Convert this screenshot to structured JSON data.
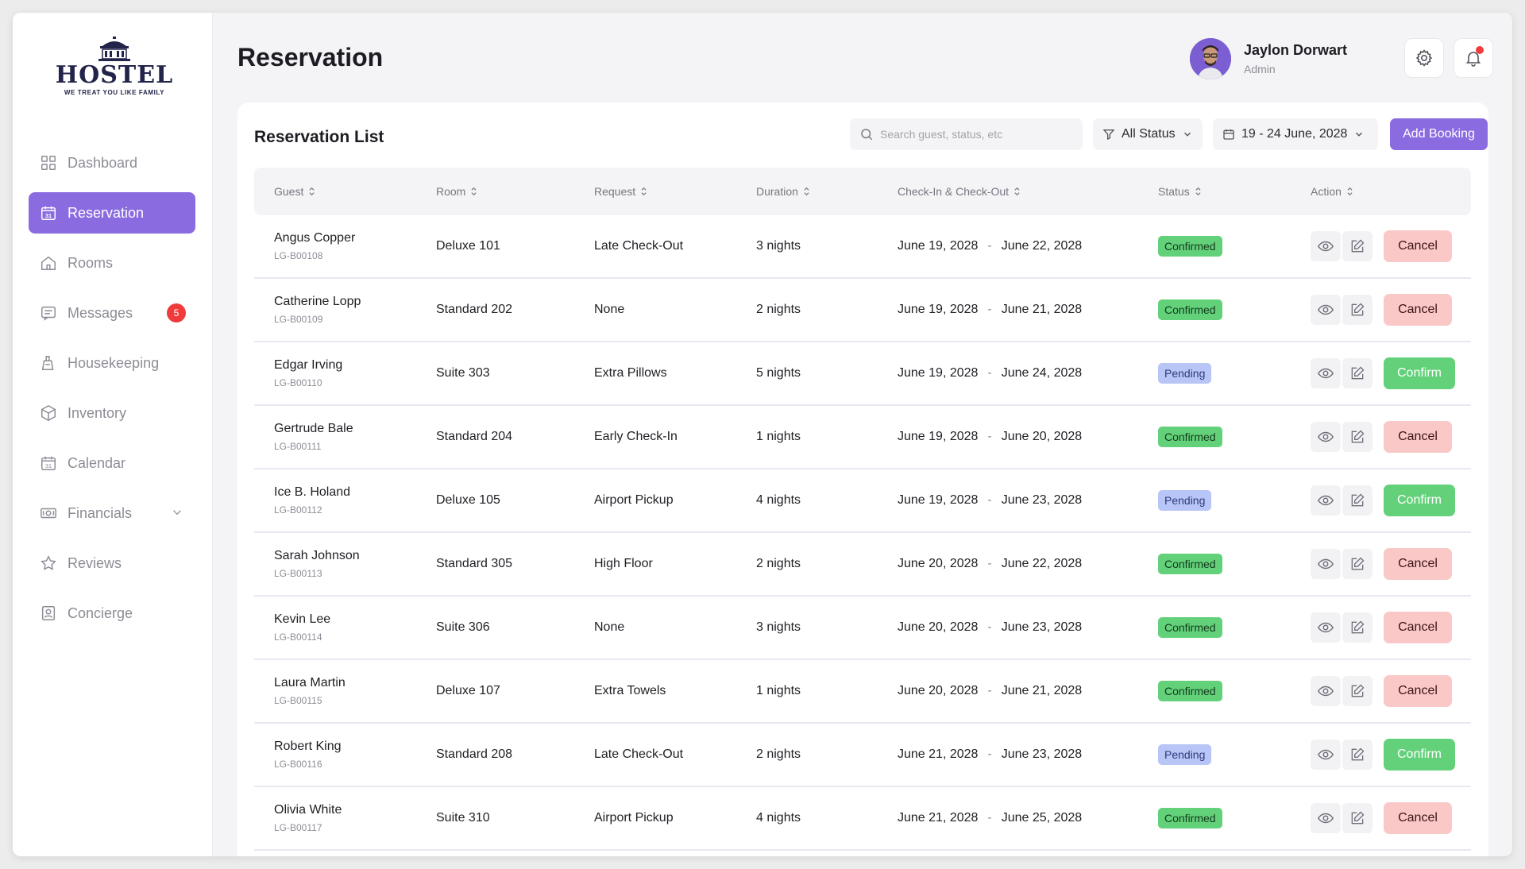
{
  "brand": {
    "name": "HOSTEL",
    "tagline": "WE TREAT YOU LIKE FAMILY"
  },
  "sidebar": {
    "items": [
      {
        "label": "Dashboard",
        "icon": "grid-icon",
        "active": false
      },
      {
        "label": "Reservation",
        "icon": "calendar-31-icon",
        "active": true
      },
      {
        "label": "Rooms",
        "icon": "home-icon",
        "active": false
      },
      {
        "label": "Messages",
        "icon": "message-icon",
        "active": false,
        "badge": "5"
      },
      {
        "label": "Housekeeping",
        "icon": "housekeeping-icon",
        "active": false
      },
      {
        "label": "Inventory",
        "icon": "box-icon",
        "active": false
      },
      {
        "label": "Calendar",
        "icon": "calendar-icon",
        "active": false
      },
      {
        "label": "Financials",
        "icon": "money-icon",
        "active": false,
        "expandable": true
      },
      {
        "label": "Reviews",
        "icon": "star-icon",
        "active": false
      },
      {
        "label": "Concierge",
        "icon": "concierge-icon",
        "active": false
      }
    ]
  },
  "header": {
    "title": "Reservation",
    "user": {
      "name": "Jaylon Dorwart",
      "role": "Admin"
    }
  },
  "panel": {
    "title": "Reservation List",
    "search_placeholder": "Search guest, status, etc",
    "status_filter": "All Status",
    "date_range": "19 - 24 June, 2028",
    "add_label": "Add Booking"
  },
  "table": {
    "columns": [
      "Guest",
      "Room",
      "Request",
      "Duration",
      "Check-In & Check-Out",
      "Status",
      "Action"
    ],
    "rows": [
      {
        "guest": "Angus Copper",
        "id": "LG-B00108",
        "room": "Deluxe 101",
        "request": "Late Check-Out",
        "duration": "3 nights",
        "checkin": "June 19, 2028",
        "checkout": "June 22, 2028",
        "status": "Confirmed",
        "action": "Cancel"
      },
      {
        "guest": "Catherine Lopp",
        "id": "LG-B00109",
        "room": "Standard 202",
        "request": "None",
        "duration": "2 nights",
        "checkin": "June 19, 2028",
        "checkout": "June 21, 2028",
        "status": "Confirmed",
        "action": "Cancel"
      },
      {
        "guest": "Edgar Irving",
        "id": "LG-B00110",
        "room": "Suite 303",
        "request": "Extra Pillows",
        "duration": "5 nights",
        "checkin": "June 19, 2028",
        "checkout": "June 24, 2028",
        "status": "Pending",
        "action": "Confirm"
      },
      {
        "guest": "Gertrude Bale",
        "id": "LG-B00111",
        "room": "Standard 204",
        "request": "Early Check-In",
        "duration": "1 nights",
        "checkin": "June 19, 2028",
        "checkout": "June 20, 2028",
        "status": "Confirmed",
        "action": "Cancel"
      },
      {
        "guest": "Ice B. Holand",
        "id": "LG-B00112",
        "room": "Deluxe 105",
        "request": "Airport Pickup",
        "duration": "4 nights",
        "checkin": "June 19, 2028",
        "checkout": "June 23, 2028",
        "status": "Pending",
        "action": "Confirm"
      },
      {
        "guest": "Sarah Johnson",
        "id": "LG-B00113",
        "room": "Standard 305",
        "request": "High Floor",
        "duration": "2 nights",
        "checkin": "June 20, 2028",
        "checkout": "June 22, 2028",
        "status": "Confirmed",
        "action": "Cancel"
      },
      {
        "guest": "Kevin Lee",
        "id": "LG-B00114",
        "room": "Suite 306",
        "request": "None",
        "duration": "3 nights",
        "checkin": "June 20, 2028",
        "checkout": "June 23, 2028",
        "status": "Confirmed",
        "action": "Cancel"
      },
      {
        "guest": "Laura Martin",
        "id": "LG-B00115",
        "room": "Deluxe 107",
        "request": "Extra Towels",
        "duration": "1 nights",
        "checkin": "June 20, 2028",
        "checkout": "June 21, 2028",
        "status": "Confirmed",
        "action": "Cancel"
      },
      {
        "guest": "Robert King",
        "id": "LG-B00116",
        "room": "Standard 208",
        "request": "Late Check-Out",
        "duration": "2 nights",
        "checkin": "June 21, 2028",
        "checkout": "June 23, 2028",
        "status": "Pending",
        "action": "Confirm"
      },
      {
        "guest": "Olivia White",
        "id": "LG-B00117",
        "room": "Suite 310",
        "request": "Airport Pickup",
        "duration": "4 nights",
        "checkin": "June 21, 2028",
        "checkout": "June 25, 2028",
        "status": "Confirmed",
        "action": "Cancel"
      }
    ]
  },
  "colors": {
    "accent": "#8a6be0",
    "confirmed": "#63d17a",
    "pending": "#b8c6f7",
    "cancel": "#fbc8c8",
    "badge": "#ef3b3b"
  }
}
